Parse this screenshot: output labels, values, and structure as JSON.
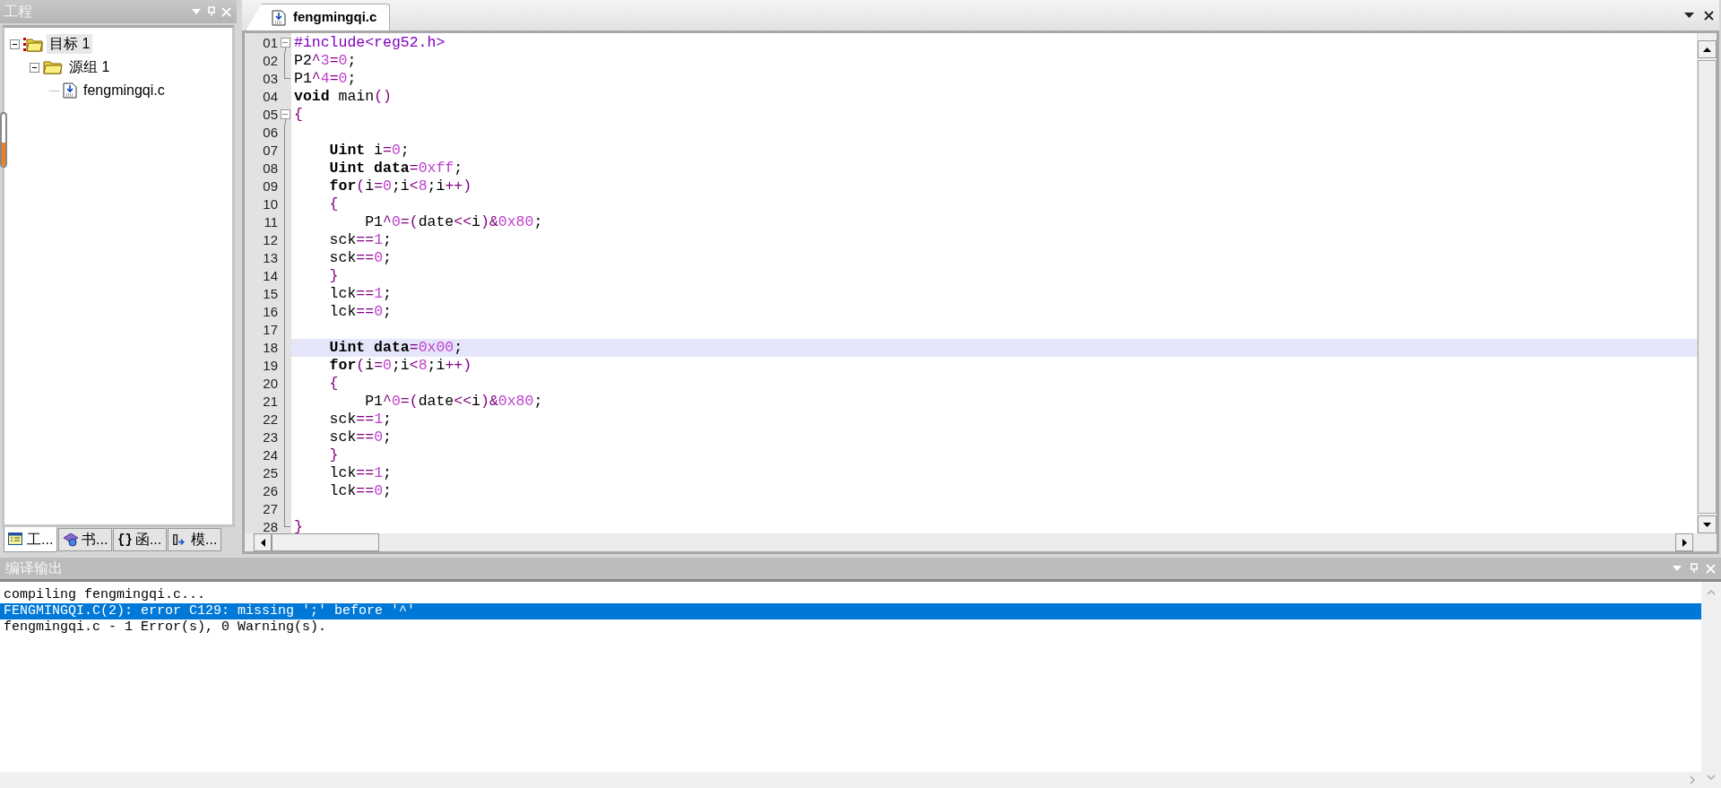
{
  "project_panel": {
    "title": "工程",
    "tree": [
      {
        "label": "目标 1",
        "kind": "target",
        "selected": true,
        "expanded": true,
        "children": [
          {
            "label": "源组 1",
            "kind": "group",
            "selected": false,
            "expanded": true,
            "children": [
              {
                "label": "fengmingqi.c",
                "kind": "file",
                "selected": false
              }
            ]
          }
        ]
      }
    ],
    "tabs": [
      {
        "label": "工...",
        "kind": "project",
        "selected": true
      },
      {
        "label": "书...",
        "kind": "books",
        "selected": false
      },
      {
        "label": "函...",
        "kind": "functions",
        "icon_text": "{}",
        "selected": false
      },
      {
        "label": "模...",
        "kind": "templates",
        "selected": false
      }
    ]
  },
  "editor": {
    "tabs": [
      {
        "label": "fengmingqi.c",
        "selected": true
      }
    ],
    "lines": [
      {
        "number": "01",
        "expanded": true,
        "guide": false,
        "selected": false,
        "tokens": [
          {
            "kind": "pre",
            "text": "#include<reg52.h>"
          }
        ]
      },
      {
        "number": "02",
        "guide": true,
        "selected": false,
        "tokens": [
          {
            "kind": "plain",
            "text": "P2"
          },
          {
            "kind": "op",
            "text": "^"
          },
          {
            "kind": "num",
            "text": "3"
          },
          {
            "kind": "op",
            "text": "="
          },
          {
            "kind": "num",
            "text": "0"
          },
          {
            "kind": "plain",
            "text": ";"
          }
        ]
      },
      {
        "number": "03",
        "guide": true,
        "selected": false,
        "tokens": [
          {
            "kind": "plain",
            "text": "P1"
          },
          {
            "kind": "op",
            "text": "^"
          },
          {
            "kind": "num",
            "text": "4"
          },
          {
            "kind": "op",
            "text": "="
          },
          {
            "kind": "num",
            "text": "0"
          },
          {
            "kind": "plain",
            "text": ";"
          }
        ]
      },
      {
        "number": "04",
        "guide": false,
        "selected": false,
        "tokens": [
          {
            "kind": "kw",
            "text": "void"
          },
          {
            "kind": "plain",
            "text": " main"
          },
          {
            "kind": "op",
            "text": "()"
          }
        ]
      },
      {
        "number": "05",
        "expanded": true,
        "guide": false,
        "selected": false,
        "tokens": [
          {
            "kind": "op",
            "text": "{"
          }
        ]
      },
      {
        "number": "06",
        "guide": true,
        "selected": false
      },
      {
        "number": "07",
        "guide": true,
        "selected": false,
        "tokens": [
          {
            "kind": "kw",
            "text": "    Uint"
          },
          {
            "kind": "plain",
            "text": " i"
          },
          {
            "kind": "op",
            "text": "="
          },
          {
            "kind": "num",
            "text": "0"
          },
          {
            "kind": "plain",
            "text": ";"
          }
        ]
      },
      {
        "number": "08",
        "guide": true,
        "selected": false,
        "tokens": [
          {
            "kind": "kw",
            "text": "    Uint data"
          },
          {
            "kind": "op",
            "text": "="
          },
          {
            "kind": "num",
            "text": "0xff"
          },
          {
            "kind": "plain",
            "text": ";"
          }
        ]
      },
      {
        "number": "09",
        "guide": true,
        "selected": false,
        "tokens": [
          {
            "kind": "kw",
            "text": "    for"
          },
          {
            "kind": "op",
            "text": "("
          },
          {
            "kind": "plain",
            "text": "i"
          },
          {
            "kind": "op",
            "text": "="
          },
          {
            "kind": "num",
            "text": "0"
          },
          {
            "kind": "plain",
            "text": ";i"
          },
          {
            "kind": "op",
            "text": "<"
          },
          {
            "kind": "num",
            "text": "8"
          },
          {
            "kind": "plain",
            "text": ";i"
          },
          {
            "kind": "op",
            "text": "++)"
          }
        ]
      },
      {
        "number": "10",
        "guide": true,
        "selected": false,
        "tokens": [
          {
            "kind": "op",
            "text": "    {"
          }
        ]
      },
      {
        "number": "11",
        "guide": true,
        "selected": false,
        "tokens": [
          {
            "kind": "plain",
            "text": "        P1"
          },
          {
            "kind": "op",
            "text": "^"
          },
          {
            "kind": "num",
            "text": "0"
          },
          {
            "kind": "op",
            "text": "=("
          },
          {
            "kind": "plain",
            "text": "date"
          },
          {
            "kind": "op",
            "text": "<<"
          },
          {
            "kind": "plain",
            "text": "i"
          },
          {
            "kind": "op",
            "text": ")&"
          },
          {
            "kind": "num",
            "text": "0x80"
          },
          {
            "kind": "plain",
            "text": ";"
          }
        ]
      },
      {
        "number": "12",
        "guide": true,
        "selected": false,
        "tokens": [
          {
            "kind": "plain",
            "text": "    sck"
          },
          {
            "kind": "op",
            "text": "=="
          },
          {
            "kind": "num",
            "text": "1"
          },
          {
            "kind": "plain",
            "text": ";"
          }
        ]
      },
      {
        "number": "13",
        "guide": true,
        "selected": false,
        "tokens": [
          {
            "kind": "plain",
            "text": "    sck"
          },
          {
            "kind": "op",
            "text": "=="
          },
          {
            "kind": "num",
            "text": "0"
          },
          {
            "kind": "plain",
            "text": ";"
          }
        ]
      },
      {
        "number": "14",
        "guide": true,
        "selected": false,
        "tokens": [
          {
            "kind": "op",
            "text": "    }"
          }
        ]
      },
      {
        "number": "15",
        "guide": true,
        "selected": false,
        "tokens": [
          {
            "kind": "plain",
            "text": "    lck"
          },
          {
            "kind": "op",
            "text": "=="
          },
          {
            "kind": "num",
            "text": "1"
          },
          {
            "kind": "plain",
            "text": ";"
          }
        ]
      },
      {
        "number": "16",
        "guide": true,
        "selected": false,
        "tokens": [
          {
            "kind": "plain",
            "text": "    lck"
          },
          {
            "kind": "op",
            "text": "=="
          },
          {
            "kind": "num",
            "text": "0"
          },
          {
            "kind": "plain",
            "text": ";"
          }
        ]
      },
      {
        "number": "17",
        "guide": true,
        "selected": false
      },
      {
        "number": "18",
        "guide": true,
        "selected": true,
        "tokens": [
          {
            "kind": "kw",
            "text": "    Uint data"
          },
          {
            "kind": "op",
            "text": "="
          },
          {
            "kind": "num",
            "text": "0x00"
          },
          {
            "kind": "plain",
            "text": ";"
          }
        ]
      },
      {
        "number": "19",
        "guide": true,
        "selected": false,
        "tokens": [
          {
            "kind": "kw",
            "text": "    for"
          },
          {
            "kind": "op",
            "text": "("
          },
          {
            "kind": "plain",
            "text": "i"
          },
          {
            "kind": "op",
            "text": "="
          },
          {
            "kind": "num",
            "text": "0"
          },
          {
            "kind": "plain",
            "text": ";i"
          },
          {
            "kind": "op",
            "text": "<"
          },
          {
            "kind": "num",
            "text": "8"
          },
          {
            "kind": "plain",
            "text": ";i"
          },
          {
            "kind": "op",
            "text": "++)"
          }
        ]
      },
      {
        "number": "20",
        "guide": true,
        "selected": false,
        "tokens": [
          {
            "kind": "op",
            "text": "    {"
          }
        ]
      },
      {
        "number": "21",
        "guide": true,
        "selected": false,
        "tokens": [
          {
            "kind": "plain",
            "text": "        P1"
          },
          {
            "kind": "op",
            "text": "^"
          },
          {
            "kind": "num",
            "text": "0"
          },
          {
            "kind": "op",
            "text": "=("
          },
          {
            "kind": "plain",
            "text": "date"
          },
          {
            "kind": "op",
            "text": "<<"
          },
          {
            "kind": "plain",
            "text": "i"
          },
          {
            "kind": "op",
            "text": ")&"
          },
          {
            "kind": "num",
            "text": "0x80"
          },
          {
            "kind": "plain",
            "text": ";"
          }
        ]
      },
      {
        "number": "22",
        "guide": true,
        "selected": false,
        "tokens": [
          {
            "kind": "plain",
            "text": "    sck"
          },
          {
            "kind": "op",
            "text": "=="
          },
          {
            "kind": "num",
            "text": "1"
          },
          {
            "kind": "plain",
            "text": ";"
          }
        ]
      },
      {
        "number": "23",
        "guide": true,
        "selected": false,
        "tokens": [
          {
            "kind": "plain",
            "text": "    sck"
          },
          {
            "kind": "op",
            "text": "=="
          },
          {
            "kind": "num",
            "text": "0"
          },
          {
            "kind": "plain",
            "text": ";"
          }
        ]
      },
      {
        "number": "24",
        "guide": true,
        "selected": false,
        "tokens": [
          {
            "kind": "op",
            "text": "    }"
          }
        ]
      },
      {
        "number": "25",
        "guide": true,
        "selected": false,
        "tokens": [
          {
            "kind": "plain",
            "text": "    lck"
          },
          {
            "kind": "op",
            "text": "=="
          },
          {
            "kind": "num",
            "text": "1"
          },
          {
            "kind": "plain",
            "text": ";"
          }
        ]
      },
      {
        "number": "26",
        "guide": true,
        "selected": false,
        "tokens": [
          {
            "kind": "plain",
            "text": "    lck"
          },
          {
            "kind": "op",
            "text": "=="
          },
          {
            "kind": "num",
            "text": "0"
          },
          {
            "kind": "plain",
            "text": ";"
          }
        ]
      },
      {
        "number": "27",
        "guide": true,
        "selected": false
      },
      {
        "number": "28",
        "guide": true,
        "selected": false,
        "tokens": [
          {
            "kind": "op",
            "text": "}"
          }
        ]
      }
    ]
  },
  "output_panel": {
    "title": "编译输出",
    "lines": [
      {
        "text": "compiling fengmingqi.c...",
        "selected": false
      },
      {
        "text": "FENGMINGQI.C(2): error C129: missing ';' before '^'",
        "selected": true
      },
      {
        "text": "fengmingqi.c - 1 Error(s), 0 Warning(s).",
        "selected": false
      }
    ]
  }
}
